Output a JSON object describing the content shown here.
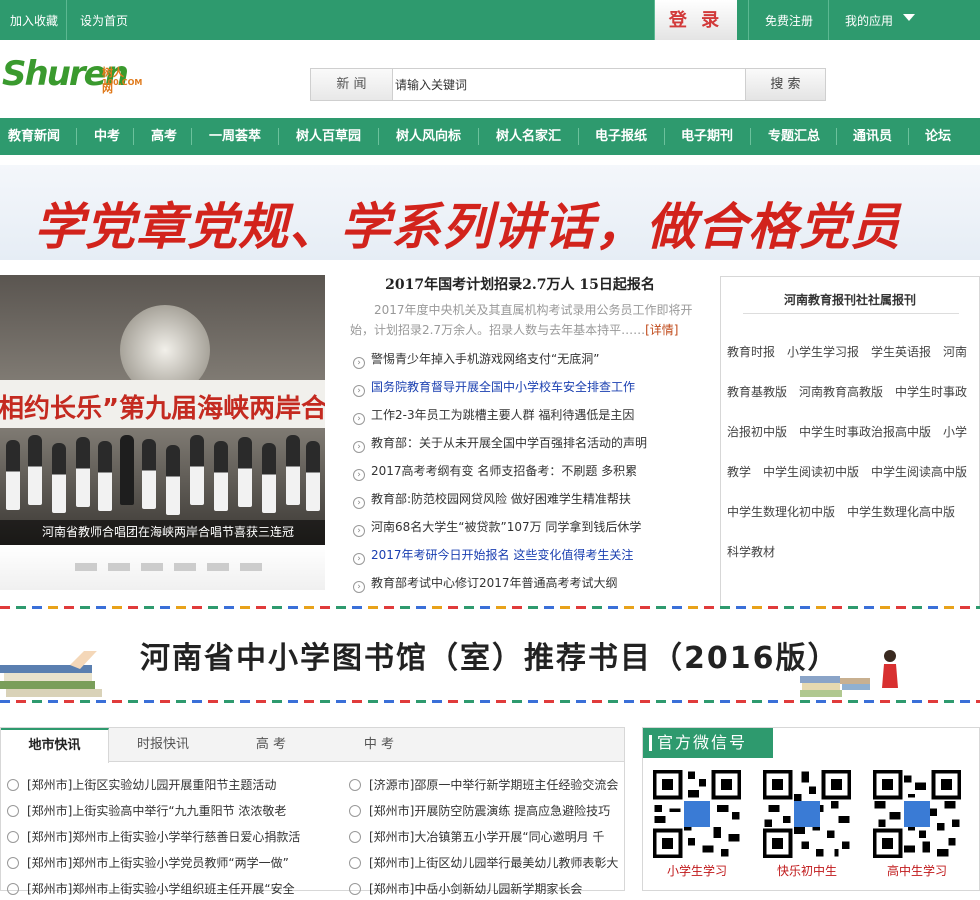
{
  "topbar": {
    "add_favorite": "加入收藏",
    "set_homepage": "设为首页",
    "login": "登 录",
    "register": "免费注册",
    "my_apps": "我的应用"
  },
  "logo": {
    "text": "Shuren",
    "cn": "树人网",
    "domain": "100.COM"
  },
  "search": {
    "category": "新 闻",
    "placeholder": "请输入关键词",
    "button": "搜 索"
  },
  "nav": [
    "教育新闻",
    "中考",
    "高考",
    "一周荟萃",
    "树人百草园",
    "树人风向标",
    "树人名家汇",
    "电子报纸",
    "电子期刊",
    "专题汇总",
    "通讯员",
    "论坛"
  ],
  "banner1": {
    "text": "学党章党规、学系列讲话，做合格党员"
  },
  "slider": {
    "stage_text": "相约长乐”第九届海峡两岸合唱节",
    "caption": "河南省教师合唱团在海峡两岸合唱节喜获三连冠"
  },
  "news": {
    "headline": "2017年国考计划招录2.7万人 15日起报名",
    "summary": "2017年度中央机关及其直属机构考试录用公务员工作即将开始，计划招录2.7万余人。招录人数与去年基本持平……",
    "more": "[详情]",
    "items": [
      {
        "text": "警惕青少年掉入手机游戏网络支付“无底洞”",
        "blue": false
      },
      {
        "text": "国务院教育督导开展全国中小学校车安全排查工作",
        "blue": true
      },
      {
        "text": "工作2-3年员工为跳槽主要人群 福利待遇低是主因",
        "blue": false
      },
      {
        "text": "教育部：关于从未开展全国中学百强排名活动的声明",
        "blue": false
      },
      {
        "text": "2017高考考纲有变 名师支招备考：不刷题 多积累",
        "blue": false
      },
      {
        "text": "教育部:防范校园网贷风险 做好困难学生精准帮扶",
        "blue": false
      },
      {
        "text": "河南68名大学生“被贷款”107万 同学拿到钱后休学",
        "blue": false
      },
      {
        "text": "2017年考研今日开始报名 这些变化值得考生关注",
        "blue": true
      },
      {
        "text": "教育部考试中心修订2017年普通高考考试大纲",
        "blue": false
      }
    ]
  },
  "papers": {
    "title": "河南教育报刊社社属报刊",
    "body": "教育时报　小学生学习报　学生英语报　河南教育基教版　河南教育高教版　中学生时事政治报初中版　中学生时事政治报高中版　小学教学　中学生阅读初中版　中学生阅读高中版　中学生数理化初中版　中学生数理化高中版　科学教材"
  },
  "banner2": {
    "text": "河南省中小学图书馆（室）推荐书目（2016版）"
  },
  "tabs": [
    "地市快讯",
    "时报快讯",
    "高 考",
    "中 考"
  ],
  "quick_news_left": [
    "[郑州市]上街区实验幼儿园开展重阳节主题活动",
    "[郑州市]上街实验高中举行“九九重阳节 浓浓敬老",
    "[郑州市]郑州市上街实验小学举行慈善日爱心捐款活",
    "[郑州市]郑州市上街实验小学党员教师“两学一做”",
    "[郑州市]郑州市上街实验小学组织班主任开展“安全"
  ],
  "quick_news_right": [
    "[济源市]邵原一中举行新学期班主任经验交流会",
    "[郑州市]开展防空防震演练 提高应急避险技巧",
    "[郑州市]大冶镇第五小学开展“同心邀明月 千",
    "[郑州市]上街区幼儿园举行最美幼儿教师表彰大",
    "[郑州市]中岳小剑新幼儿园新学期家长会"
  ],
  "wechat": {
    "title": "官方微信号",
    "codes": [
      "小学生学习",
      "快乐初中生",
      "高中生学习"
    ]
  },
  "colors": {
    "brand_green": "#2e9a6e",
    "login_red": "#d23a3a",
    "link_blue": "#1a3fb0"
  }
}
